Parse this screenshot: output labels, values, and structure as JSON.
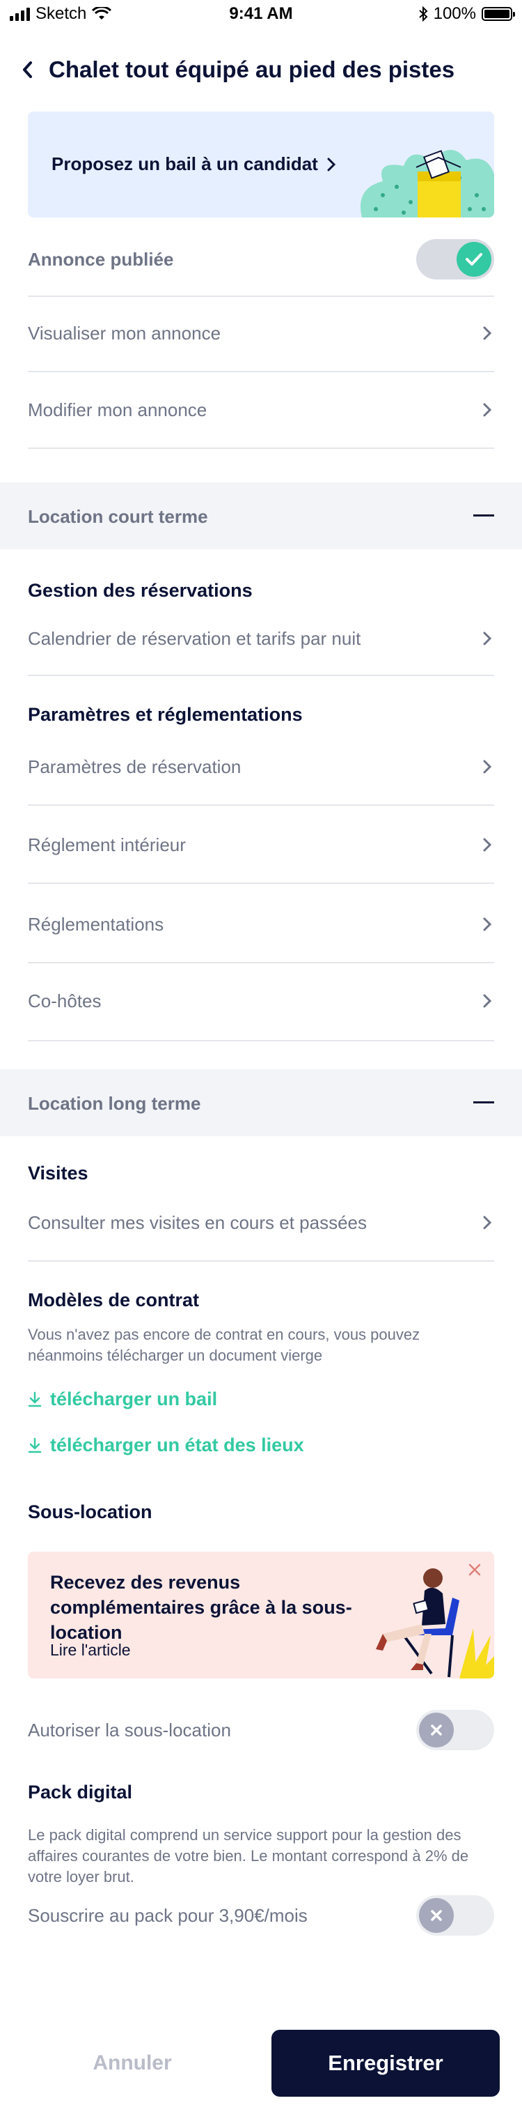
{
  "status_bar": {
    "carrier": "Sketch",
    "time": "9:41 AM",
    "battery": "100%"
  },
  "header": {
    "title": "Chalet tout équipé au pied des pistes"
  },
  "promo": {
    "label": "Proposez un bail à un candidat"
  },
  "listing": {
    "published_label": "Annonce publiée",
    "published": true,
    "items": [
      {
        "label": "Visualiser mon annonce"
      },
      {
        "label": "Modifier mon annonce"
      }
    ]
  },
  "short_term": {
    "title": "Location court terme",
    "bookings_heading": "Gestion des réservations",
    "bookings_items": [
      {
        "label": "Calendrier de réservation et tarifs par nuit"
      }
    ],
    "rules_heading": "Paramètres et réglementations",
    "rules_items": [
      {
        "label": "Paramètres de réservation"
      },
      {
        "label": "Réglement intérieur"
      },
      {
        "label": "Réglementations"
      },
      {
        "label": "Co-hôtes"
      }
    ]
  },
  "long_term": {
    "title": "Location long terme",
    "visits_heading": "Visites",
    "visits_item": "Consulter mes visites en cours et passées",
    "contracts_heading": "Modèles de contrat",
    "contracts_text": "Vous n'avez pas encore de contrat en cours, vous pouvez néanmoins télécharger un document vierge",
    "download_lease": "télécharger un bail",
    "download_inventory": "télécharger un état des lieux",
    "sublet_heading": "Sous-location",
    "sublet_card_title": "Recevez des revenus complémentaires grâce à la sous-location",
    "sublet_card_link": "Lire l'article",
    "sublet_toggle_label": "Autoriser la sous-location",
    "sublet_allowed": false,
    "pack_heading": "Pack digital",
    "pack_text": "Le pack digital comprend un service support pour la gestion des affaires courantes de votre bien. Le montant correspond à 2% de votre loyer brut.",
    "pack_toggle_label": "Souscrire au pack pour 3,90€/mois",
    "pack_subscribed": false
  },
  "footer": {
    "cancel_label": "Annuler",
    "save_label": "Enregistrer"
  },
  "colors": {
    "navy": "#0b1236",
    "accent_green": "#33c9a2",
    "muted_text": "#6e7486",
    "promo_bg": "#e6efff",
    "article_bg": "#fde8e5"
  }
}
